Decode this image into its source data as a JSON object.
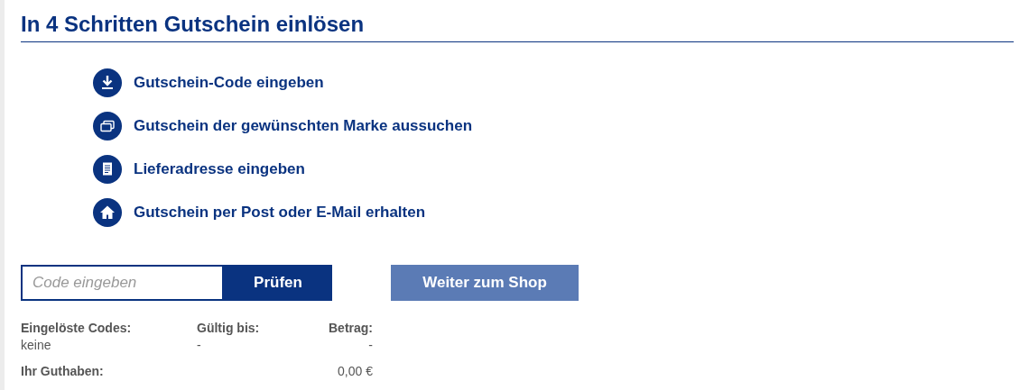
{
  "title": "In 4 Schritten Gutschein einlösen",
  "steps": [
    {
      "label": "Gutschein-Code eingeben"
    },
    {
      "label": "Gutschein der gewünschten Marke aussuchen"
    },
    {
      "label": "Lieferadresse eingeben"
    },
    {
      "label": "Gutschein per Post oder E-Mail erhalten"
    }
  ],
  "code_field": {
    "placeholder": "Code eingeben"
  },
  "check_button": "Prüfen",
  "shop_button": "Weiter zum Shop",
  "codes_table": {
    "columns": [
      "Eingelöste Codes:",
      "Gültig bis:",
      "Betrag:"
    ],
    "rows": [
      [
        "keine",
        "-",
        "-"
      ]
    ]
  },
  "balance": {
    "label": "Ihr Guthaben:",
    "value": "0,00 €"
  }
}
